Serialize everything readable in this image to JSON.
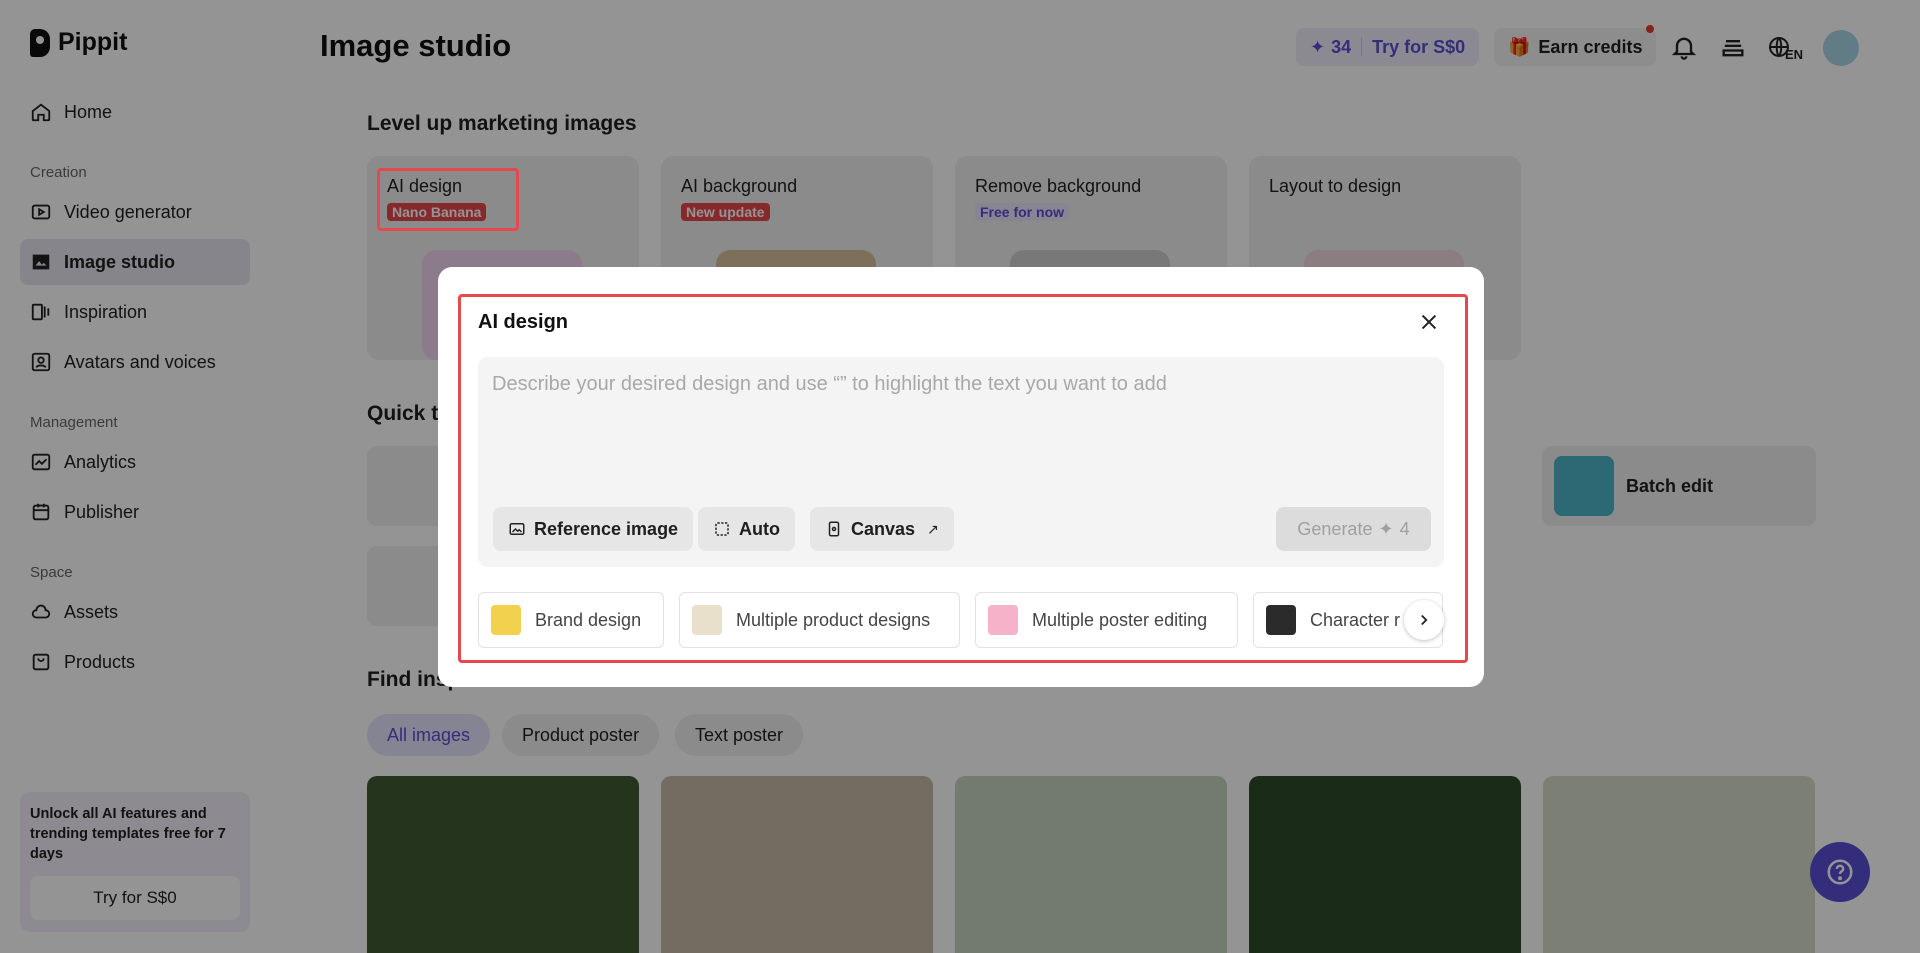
{
  "brand": {
    "name": "Pippit"
  },
  "sidebar": {
    "home": "Home",
    "sections": {
      "creation": "Creation",
      "management": "Management",
      "space": "Space"
    },
    "items": {
      "video_generator": "Video generator",
      "image_studio": "Image studio",
      "inspiration": "Inspiration",
      "avatars": "Avatars and voices",
      "analytics": "Analytics",
      "publisher": "Publisher",
      "assets": "Assets",
      "products": "Products"
    },
    "promo": {
      "text": "Unlock all AI features and trending templates free for 7 days",
      "button": "Try for S$0"
    }
  },
  "header": {
    "title": "Image studio",
    "credits": "34",
    "try_label": "Try for S$0",
    "earn_label": "Earn credits",
    "lang": "EN"
  },
  "main": {
    "level_up_title": "Level up marketing images",
    "feature_cards": [
      {
        "title": "AI design",
        "badge": "Nano Banana"
      },
      {
        "title": "AI background",
        "badge": "New update"
      },
      {
        "title": "Remove background",
        "badge": "Free for now"
      },
      {
        "title": "Layout to design"
      }
    ],
    "quick_tools_title_visible": "Quick t",
    "batch_edit": "Batch edit",
    "find_title_visible": "Find insp",
    "chips": [
      "All images",
      "Product poster",
      "Text poster"
    ]
  },
  "modal": {
    "title": "AI design",
    "placeholder": "Describe your desired design and use “” to highlight the text you want to add",
    "buttons": {
      "reference": "Reference image",
      "auto": "Auto",
      "canvas": "Canvas",
      "generate": "Generate",
      "generate_cost": "4"
    },
    "suggestions": [
      "Brand design",
      "Multiple product designs",
      "Multiple poster editing",
      "Character r"
    ]
  },
  "colors": {
    "accent": "#5b4fd6",
    "highlight": "#e5484d",
    "overlay": "rgba(0,0,0,0.42)"
  }
}
